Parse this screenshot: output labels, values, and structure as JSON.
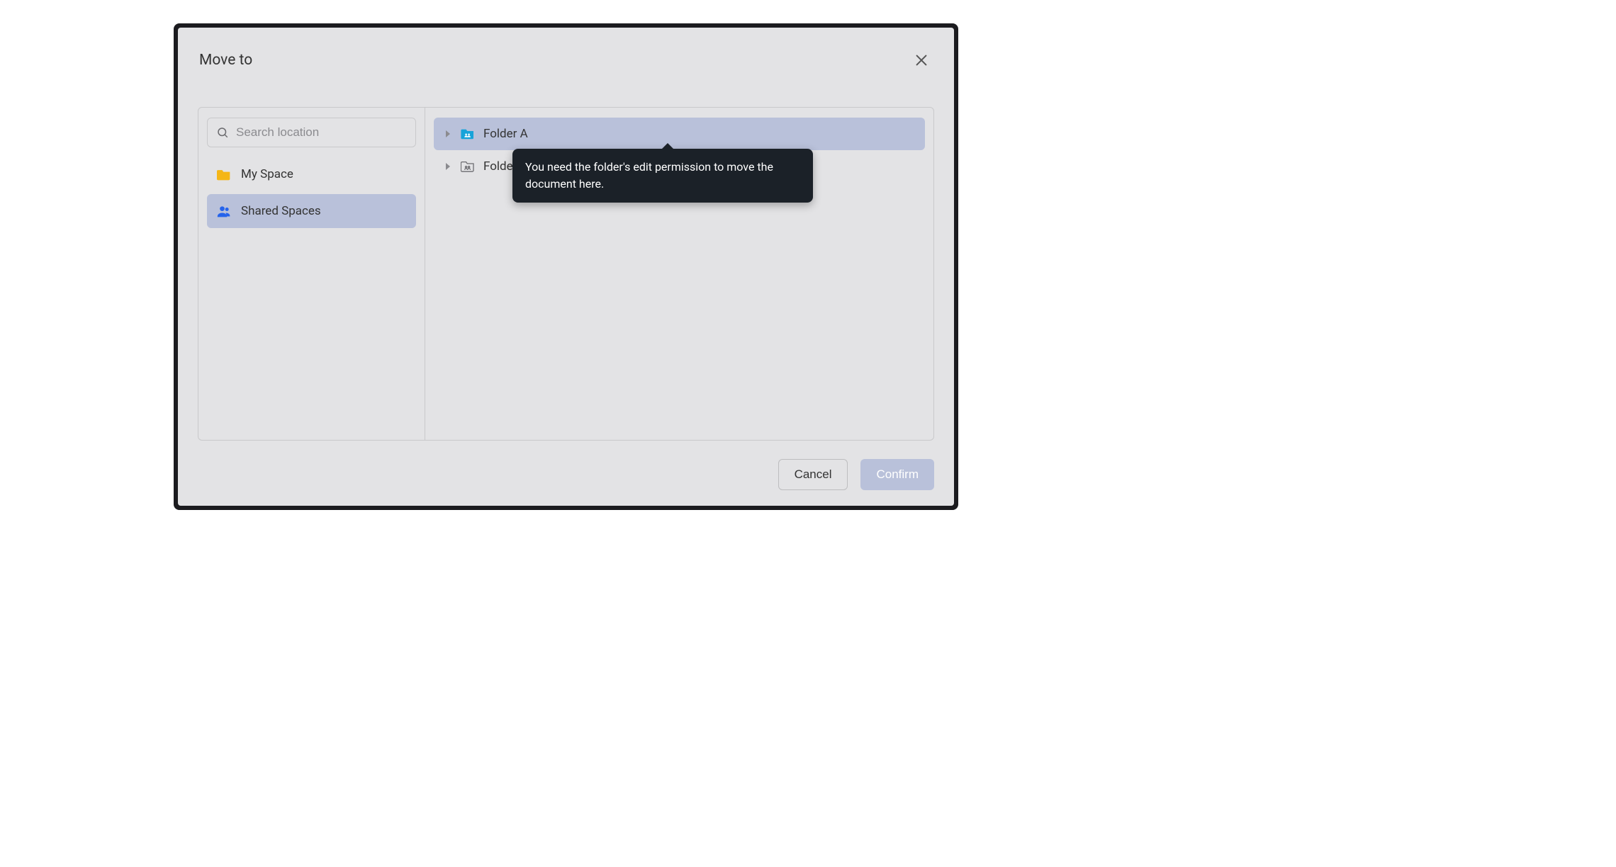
{
  "dialog": {
    "title": "Move to"
  },
  "search": {
    "placeholder": "Search location"
  },
  "sidebar": {
    "items": [
      {
        "label": "My Space"
      },
      {
        "label": "Shared Spaces"
      }
    ]
  },
  "folders": [
    {
      "label": "Folder A"
    },
    {
      "label": "Folder B"
    }
  ],
  "tooltip": {
    "text": "You need the folder's edit permission to move the document here."
  },
  "footer": {
    "cancel_label": "Cancel",
    "confirm_label": "Confirm"
  }
}
